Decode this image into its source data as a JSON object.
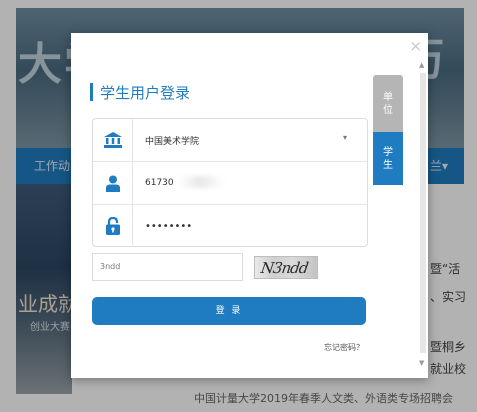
{
  "background": {
    "banner_left": "大学",
    "banner_right": "历",
    "nav_left": "工作动",
    "nav_right": "兰▾",
    "photo_text": "业成就",
    "photo_subtext": "创业大赛",
    "right_lines": [
      "暨“活",
      "、实习",
      "暨桐乡",
      "就业校"
    ],
    "bottom_text": "中国计量大学2019年春季人文类、外语类专场招聘会"
  },
  "modal": {
    "close_symbol": "×",
    "title": "学生用户登录",
    "tabs": [
      {
        "label": "单位",
        "chars": [
          "单",
          "位"
        ]
      },
      {
        "label": "学生",
        "chars": [
          "学",
          "生"
        ]
      }
    ],
    "school": {
      "value": "中国美术学院",
      "arrow": "▾"
    },
    "username": {
      "value": "61730"
    },
    "password": {
      "masked": "••••••••"
    },
    "captcha": {
      "input_value": "3ndd",
      "image_text": "N3ndd"
    },
    "login_button": "登 录",
    "forgot_link": "忘记密码？"
  },
  "colors": {
    "accent": "#1f7cc1",
    "inactive_tab": "#b5b5b5"
  },
  "icons": {
    "school": "bank-building-icon",
    "user": "person-icon",
    "password": "padlock-icon",
    "close": "close-icon"
  }
}
